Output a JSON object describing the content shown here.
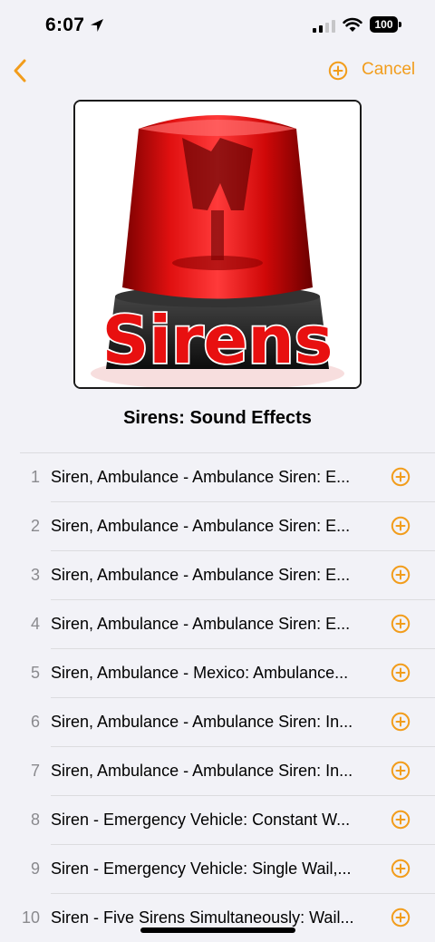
{
  "status_bar": {
    "time": "6:07",
    "battery": "100"
  },
  "nav": {
    "cancel_label": "Cancel"
  },
  "album": {
    "title": "Sirens: Sound Effects",
    "artwork_text": "Sirens"
  },
  "colors": {
    "accent": "#f29d1c",
    "background": "#f2f2f7"
  },
  "tracks": [
    {
      "num": "1",
      "title": "Siren, Ambulance - Ambulance Siren: E..."
    },
    {
      "num": "2",
      "title": "Siren, Ambulance - Ambulance Siren: E..."
    },
    {
      "num": "3",
      "title": "Siren, Ambulance - Ambulance Siren: E..."
    },
    {
      "num": "4",
      "title": "Siren, Ambulance - Ambulance Siren: E..."
    },
    {
      "num": "5",
      "title": "Siren, Ambulance - Mexico: Ambulance..."
    },
    {
      "num": "6",
      "title": "Siren, Ambulance - Ambulance Siren: In..."
    },
    {
      "num": "7",
      "title": "Siren, Ambulance - Ambulance Siren: In..."
    },
    {
      "num": "8",
      "title": "Siren - Emergency Vehicle: Constant W..."
    },
    {
      "num": "9",
      "title": "Siren - Emergency Vehicle: Single Wail,..."
    },
    {
      "num": "10",
      "title": "Siren - Five Sirens Simultaneously: Wail..."
    }
  ]
}
